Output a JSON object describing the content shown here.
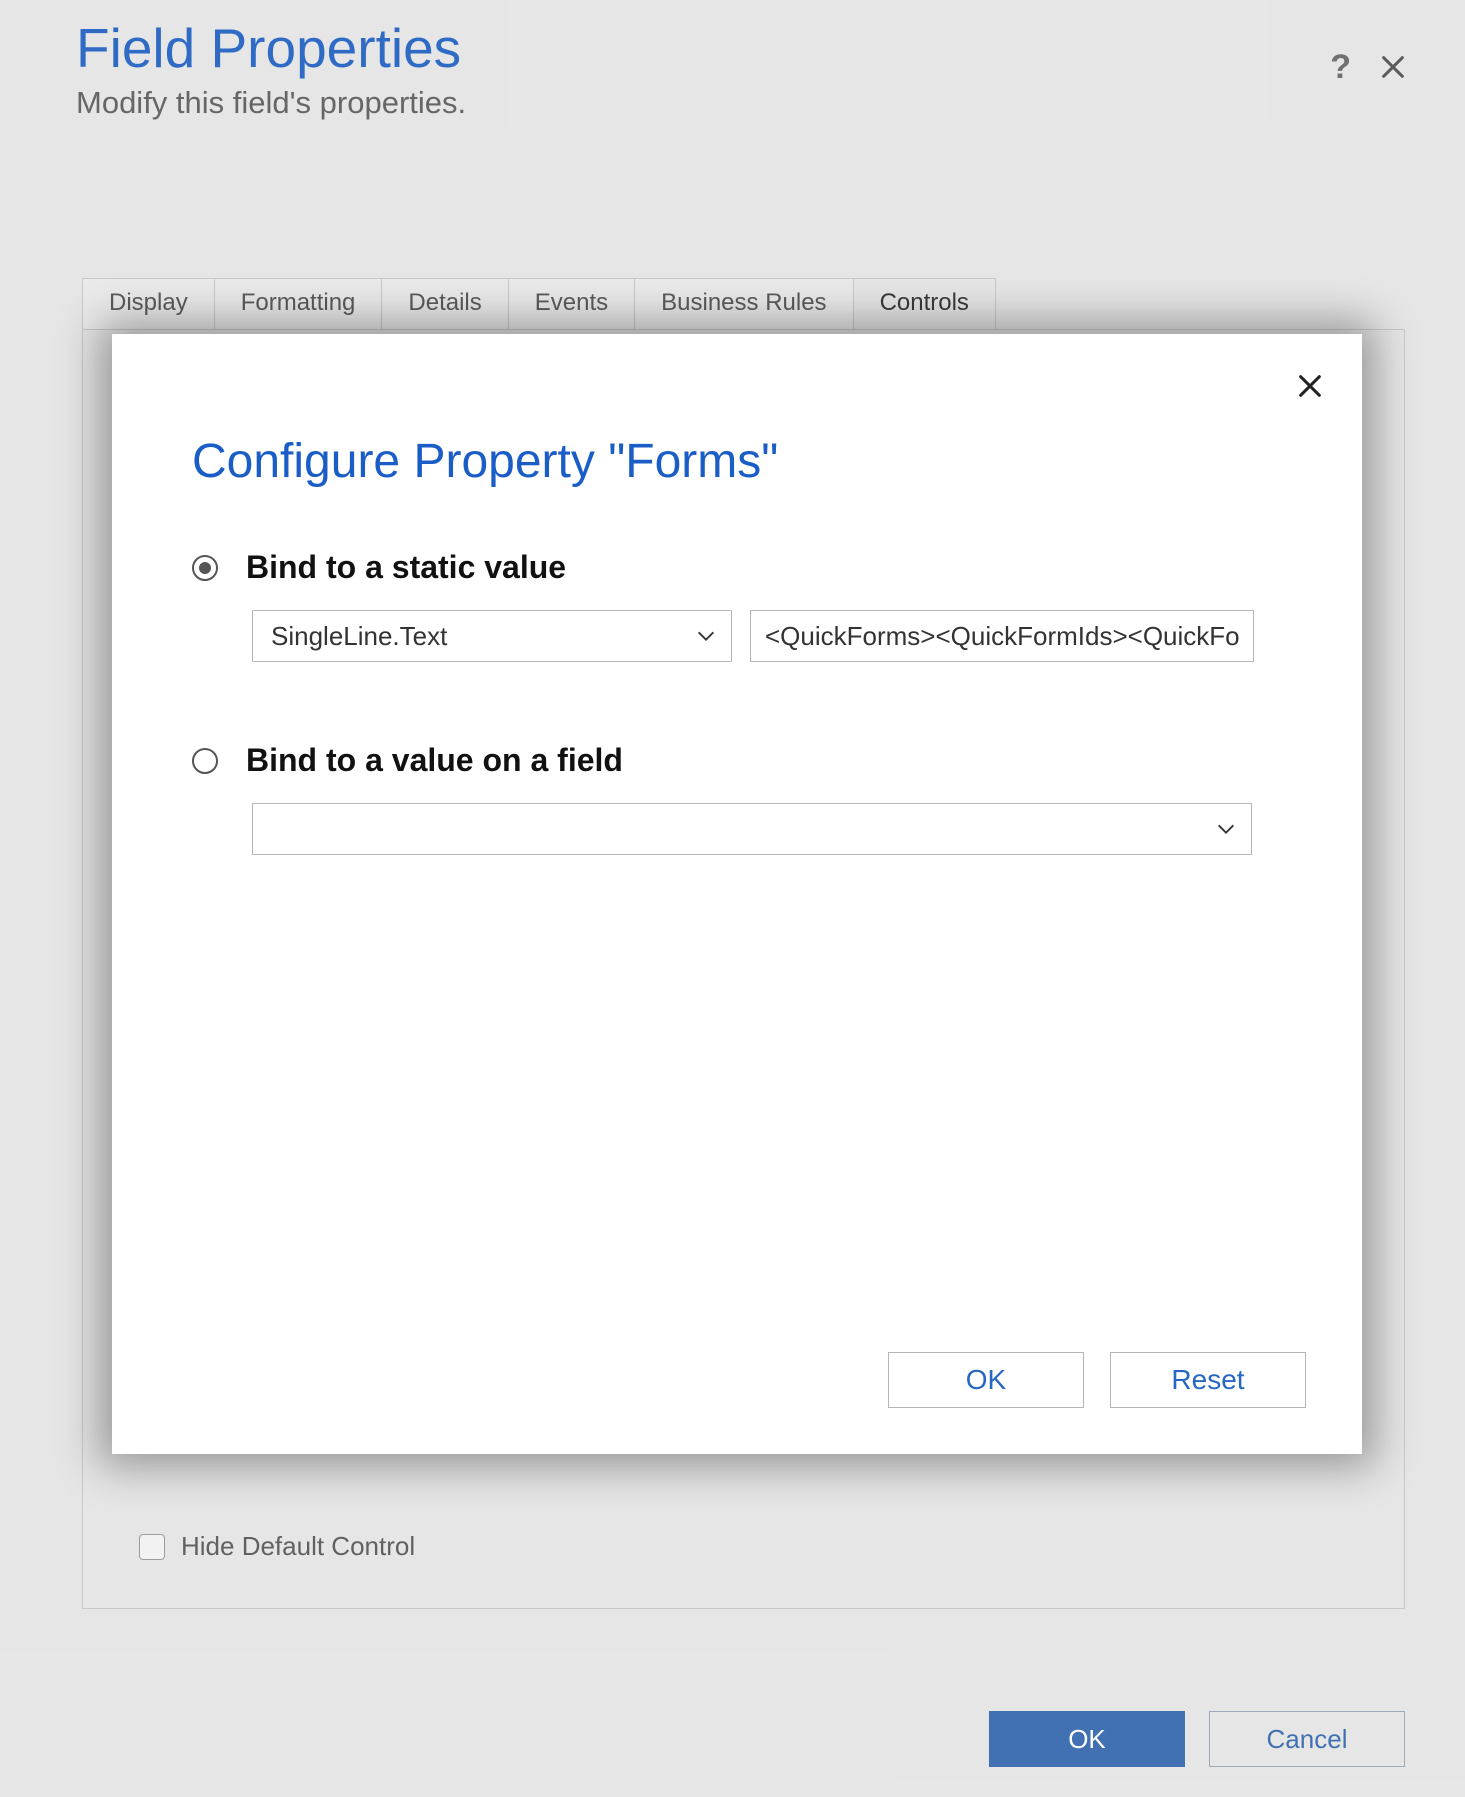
{
  "header": {
    "title": "Field Properties",
    "subtitle": "Modify this field's properties.",
    "help_tooltip": "?",
    "close_tooltip": "Close"
  },
  "tabs": {
    "items": [
      "Display",
      "Formatting",
      "Details",
      "Events",
      "Business Rules",
      "Controls"
    ],
    "active_index": 5
  },
  "panel": {
    "hide_default_label": "Hide Default Control",
    "hide_default_checked": false
  },
  "outer_footer": {
    "ok_label": "OK",
    "cancel_label": "Cancel"
  },
  "modal": {
    "title": "Configure Property \"Forms\"",
    "close_tooltip": "Close",
    "option_static": {
      "label": "Bind to a static value",
      "selected": true,
      "type_value": "SingleLine.Text",
      "value_input": "<QuickForms><QuickFormIds><QuickFo"
    },
    "option_field": {
      "label": "Bind to a value on a field",
      "selected": false,
      "field_value": ""
    },
    "footer": {
      "ok_label": "OK",
      "reset_label": "Reset"
    }
  }
}
